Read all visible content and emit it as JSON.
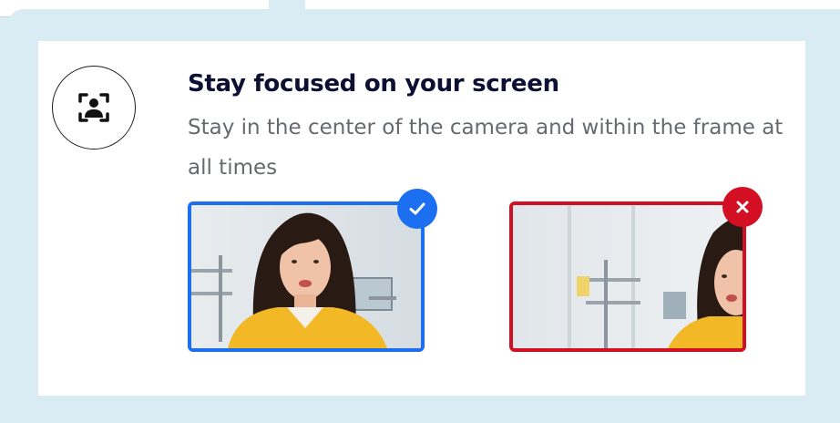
{
  "card": {
    "title": "Stay focused on your screen",
    "description": "Stay in the center of the camera and within the frame at all times"
  },
  "icons": {
    "header": "face-frame-icon",
    "good": "checkmark-icon",
    "bad": "x-mark-icon"
  },
  "colors": {
    "background": "#d9ebf3",
    "good": "#1d6ff2",
    "bad": "#d20f23",
    "title": "#0d1033",
    "body": "#666a6f"
  }
}
